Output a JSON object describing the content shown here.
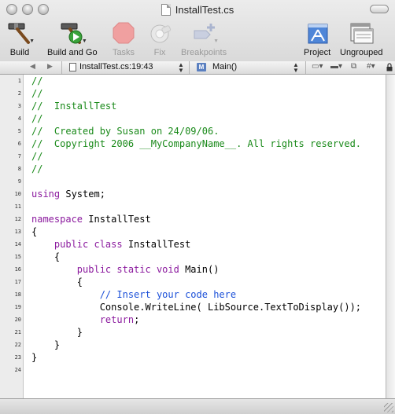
{
  "window": {
    "title": "InstallTest.cs"
  },
  "toolbar": {
    "items": [
      {
        "label": "Build",
        "icon": "hammer-icon",
        "enabled": true
      },
      {
        "label": "Build and Go",
        "icon": "hammer-play-icon",
        "enabled": true
      },
      {
        "label": "Tasks",
        "icon": "stop-octagon-icon",
        "enabled": false
      },
      {
        "label": "Fix",
        "icon": "bandage-icon",
        "enabled": false
      },
      {
        "label": "Breakpoints",
        "icon": "breakpoint-plus-icon",
        "enabled": false
      },
      {
        "label": "Project",
        "icon": "project-icon",
        "enabled": true
      },
      {
        "label": "Ungrouped",
        "icon": "ungrouped-icon",
        "enabled": true
      }
    ]
  },
  "navbar": {
    "file_location": "InstallTest.cs:19:43",
    "function": "Main()",
    "badge": "M",
    "hash": "#"
  },
  "editor": {
    "lines": [
      {
        "n": "1",
        "segs": [
          [
            "c",
            "//"
          ]
        ]
      },
      {
        "n": "2",
        "segs": [
          [
            "c",
            "//"
          ]
        ]
      },
      {
        "n": "3",
        "segs": [
          [
            "c",
            "//  InstallTest"
          ]
        ]
      },
      {
        "n": "4",
        "segs": [
          [
            "c",
            "//"
          ]
        ]
      },
      {
        "n": "5",
        "segs": [
          [
            "c",
            "//  Created by Susan on 24/09/06."
          ]
        ]
      },
      {
        "n": "6",
        "segs": [
          [
            "c",
            "//  Copyright 2006 __MyCompanyName__. All rights reserved."
          ]
        ]
      },
      {
        "n": "7",
        "segs": [
          [
            "c",
            "//"
          ]
        ]
      },
      {
        "n": "8",
        "segs": [
          [
            "c",
            "//"
          ]
        ]
      },
      {
        "n": "9",
        "segs": []
      },
      {
        "n": "10",
        "segs": [
          [
            "k",
            "using"
          ],
          [
            "t",
            " System;"
          ]
        ]
      },
      {
        "n": "11",
        "segs": []
      },
      {
        "n": "12",
        "segs": [
          [
            "k",
            "namespace"
          ],
          [
            "t",
            " InstallTest"
          ]
        ]
      },
      {
        "n": "13",
        "segs": [
          [
            "t",
            "{"
          ]
        ]
      },
      {
        "n": "14",
        "segs": [
          [
            "t",
            "    "
          ],
          [
            "k",
            "public class"
          ],
          [
            "t",
            " InstallTest"
          ]
        ]
      },
      {
        "n": "15",
        "segs": [
          [
            "t",
            "    {"
          ]
        ]
      },
      {
        "n": "16",
        "segs": [
          [
            "t",
            "        "
          ],
          [
            "k",
            "public static void"
          ],
          [
            "t",
            " Main()"
          ]
        ]
      },
      {
        "n": "17",
        "segs": [
          [
            "t",
            "        {"
          ]
        ]
      },
      {
        "n": "18",
        "segs": [
          [
            "t",
            "            "
          ],
          [
            "b",
            "// Insert your code here"
          ]
        ]
      },
      {
        "n": "19",
        "segs": [
          [
            "t",
            "            Console.WriteLine( LibSource.TextToDisplay());"
          ]
        ]
      },
      {
        "n": "20",
        "segs": [
          [
            "t",
            "            "
          ],
          [
            "k",
            "return"
          ],
          [
            "t",
            ";"
          ]
        ]
      },
      {
        "n": "21",
        "segs": [
          [
            "t",
            "        }"
          ]
        ]
      },
      {
        "n": "22",
        "segs": [
          [
            "t",
            "    }"
          ]
        ]
      },
      {
        "n": "23",
        "segs": [
          [
            "t",
            "}"
          ]
        ]
      },
      {
        "n": "24",
        "segs": []
      }
    ]
  },
  "colors": {
    "comment": "#1a8a1a",
    "keyword": "#8b1a9e",
    "doc_comment": "#1a4fd8"
  }
}
